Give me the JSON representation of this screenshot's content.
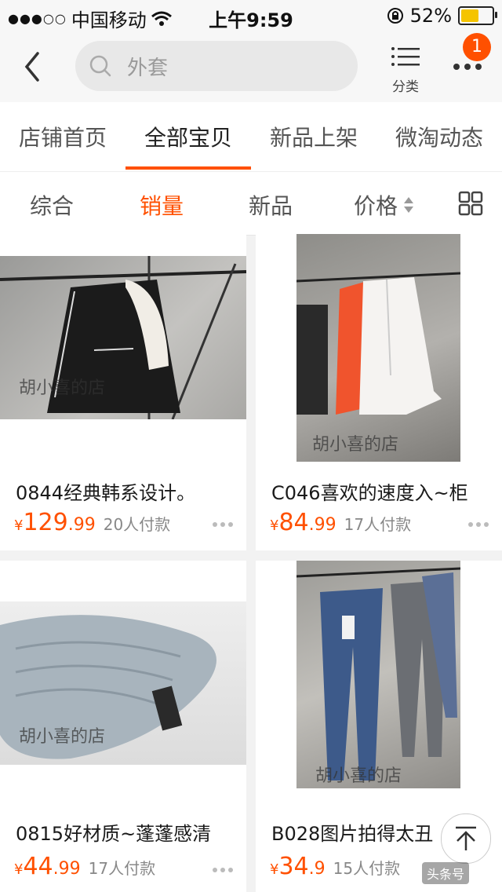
{
  "status": {
    "carrier": "中国移动",
    "time": "上午9:59",
    "battery": "52%",
    "battery_level": 0.52,
    "icons": [
      "signal-dots-icon",
      "wifi-icon",
      "rotation-lock-icon",
      "battery-icon"
    ]
  },
  "nav": {
    "search_placeholder": "外套",
    "category_label": "分类",
    "badge_count": "1",
    "icons": [
      "back-arrow-icon",
      "search-icon",
      "list-icon",
      "more-icon"
    ]
  },
  "tabs": [
    {
      "label": "店铺首页",
      "active": false
    },
    {
      "label": "全部宝贝",
      "active": true
    },
    {
      "label": "新品上架",
      "active": false
    },
    {
      "label": "微淘动态",
      "active": false
    }
  ],
  "sort": [
    {
      "label": "综合",
      "active": false
    },
    {
      "label": "销量",
      "active": true
    },
    {
      "label": "新品",
      "active": false
    },
    {
      "label": "价格",
      "active": false
    }
  ],
  "accent_color": "#ff5000",
  "products": [
    {
      "title": "0844经典韩系设计。",
      "currency": "¥",
      "price_int": "129",
      "price_dec": ".99",
      "sold": "20人付款",
      "watermark": "胡小喜的店"
    },
    {
      "title": "C046喜欢的速度入~柜",
      "currency": "¥",
      "price_int": "84",
      "price_dec": ".99",
      "sold": "17人付款",
      "watermark": "胡小喜的店"
    },
    {
      "title": "0815好材质~蓬蓬感清",
      "currency": "¥",
      "price_int": "44",
      "price_dec": ".99",
      "sold": "17人付款",
      "watermark": "胡小喜的店"
    },
    {
      "title": "B028图片拍得太丑",
      "currency": "¥",
      "price_int": "34",
      "price_dec": ".9",
      "sold": "15人付款",
      "watermark": "胡小喜的店"
    }
  ],
  "footer": {
    "source_label": "头条号"
  }
}
